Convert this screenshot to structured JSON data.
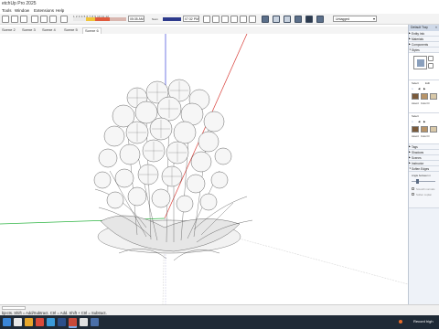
{
  "window": {
    "title": "etchUp Pro 2025"
  },
  "menu": [
    "Tools",
    "Window",
    "Extensions",
    "Help"
  ],
  "toolbar": {
    "shadow_ticks": "1 2 3 4 5 6 7 8 9 10 11 12",
    "time_value": "05:35 AM",
    "noon_label": "Noon",
    "time_value_2": "07:32 PM",
    "tag_dropdown": "Untagged"
  },
  "scene_tabs": [
    "Scene 2",
    "Scene 3",
    "Scene 4",
    "Scene 5",
    "Scene 6"
  ],
  "tray": {
    "title": "Default Tray",
    "sections": [
      "Entity Info",
      "Materials",
      "Components",
      "Styles"
    ],
    "select_label": "Select",
    "edit_label": "Edit",
    "items": [
      "Assort",
      "Color D"
    ],
    "select_label_2": "Select",
    "collapsed_sections": [
      "Tags",
      "Shadows",
      "Scenes",
      "Instructor",
      "Soften Edges"
    ],
    "soften_angle_label": "Angle between n",
    "smooth_normals": "Smooth normals",
    "soften_coplanar": "Soften coplan"
  },
  "status": {
    "text": "bjects. Shift = Add/Subtract. Ctrl = Add. Shift + Ctrl = Subtract."
  },
  "taskbar": {
    "tray_text": "Record high"
  },
  "colors": {
    "accent": "#2d5fa8",
    "red_axis": "#d9413b",
    "green_axis": "#2fb544",
    "blue_axis": "#3d44d9"
  }
}
